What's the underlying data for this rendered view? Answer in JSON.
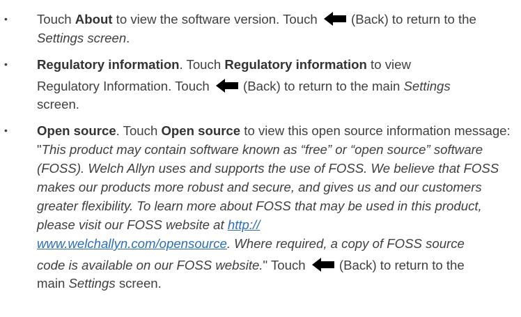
{
  "items": [
    {
      "t1": "Touch ",
      "b1": "About",
      "t2": " to view the software version. Touch ",
      "icon": "back-arrow-icon",
      "t3": " (Back) to return to the ",
      "i1": "Settings screen",
      "t4": "."
    },
    {
      "b1": "Regulatory information",
      "t1": ". Touch ",
      "b2": "Regulatory information",
      "t2": " to view",
      "t3": "Regulatory Information. Touch ",
      "icon": "back-arrow-icon",
      "t4": " (Back) to return to the main ",
      "i1": "Settings",
      "t5": "screen."
    },
    {
      "b1": "Open source",
      "t1": ". Touch ",
      "b2": "Open source",
      "t2": " to view this open source information message: \"",
      "i1": "This product may contain software known as “free” or “open source” software (FOSS). Welch Allyn uses and supports the use of FOSS. We believe that FOSS makes our products more robust and secure, and gives us and our customers greater flexibility. To learn more about FOSS that may be used in this product, please visit our FOSS website at ",
      "link_part1": "http://",
      "link_part2": "www.welchallyn.com/opensource",
      "i2": ". Where required, a copy of FOSS source",
      "i3": "code is available on our FOSS website.",
      "t3": "\" Touch ",
      "icon": "back-arrow-icon",
      "t4": " (Back) to return to the",
      "t5": "main ",
      "i4": "Settings",
      "t6": " screen."
    }
  ],
  "bullet_char": "•",
  "colors": {
    "text": "#3f3f3f",
    "link": "#2a6ebb",
    "icon": "#000000"
  }
}
